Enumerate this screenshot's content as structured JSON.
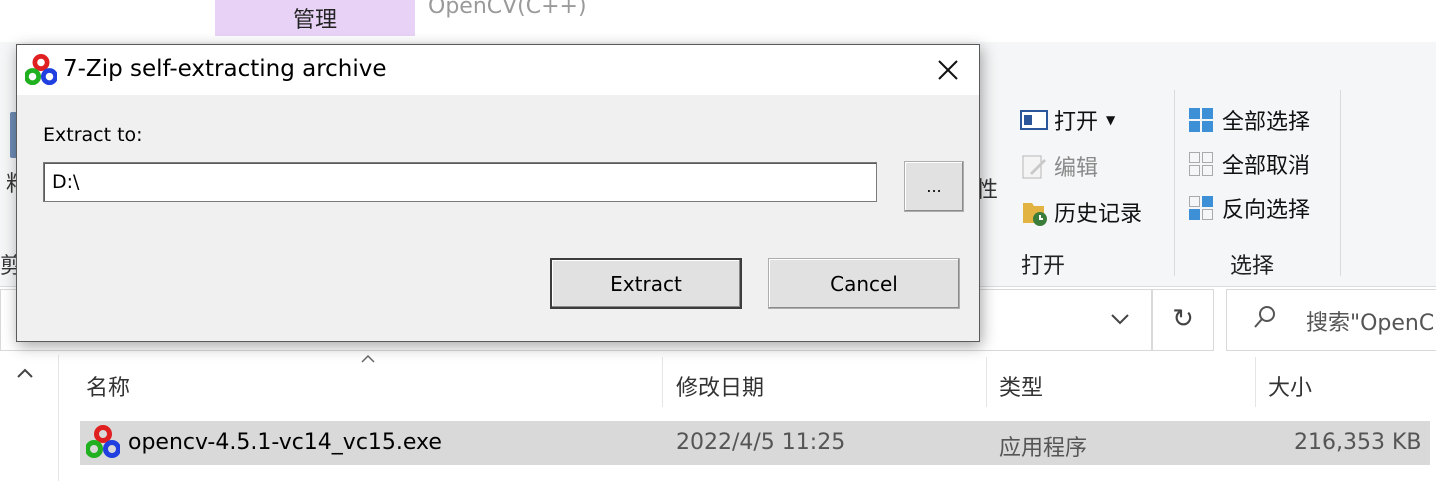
{
  "explorer": {
    "ribbon_tab_manage": "管理",
    "window_title": "OpenCV(C++)",
    "ribbon": {
      "partial_left_paste": "粘",
      "partial_left_cut": "剪",
      "partial_properties": "性",
      "open_group": {
        "label": "打开",
        "open": "打开",
        "edit": "编辑",
        "history": "历史记录"
      },
      "select_group": {
        "label": "选择",
        "select_all": "全部选择",
        "select_none": "全部取消",
        "invert_selection": "反向选择"
      }
    },
    "address": {
      "refresh_symbol": "↻",
      "dropdown_symbol": "⌄",
      "search_placeholder": "搜索\"OpenC"
    },
    "columns": {
      "name": "名称",
      "date_modified": "修改日期",
      "type": "类型",
      "size": "大小"
    },
    "files": [
      {
        "name": "opencv-4.5.1-vc14_vc15.exe",
        "date_modified": "2022/4/5 11:25",
        "type": "应用程序",
        "size": "216,353 KB"
      }
    ]
  },
  "dialog": {
    "title": "7-Zip self-extracting archive",
    "extract_label": "Extract to:",
    "path_value": "D:\\",
    "browse_label": "...",
    "extract_button": "Extract",
    "cancel_button": "Cancel"
  },
  "colors": {
    "manage_tab": "#e8d3f7",
    "selected_row": "#d9d9d9",
    "dialog_bg": "#f0f0f0",
    "ribbon_bg": "#f5f6f7"
  }
}
